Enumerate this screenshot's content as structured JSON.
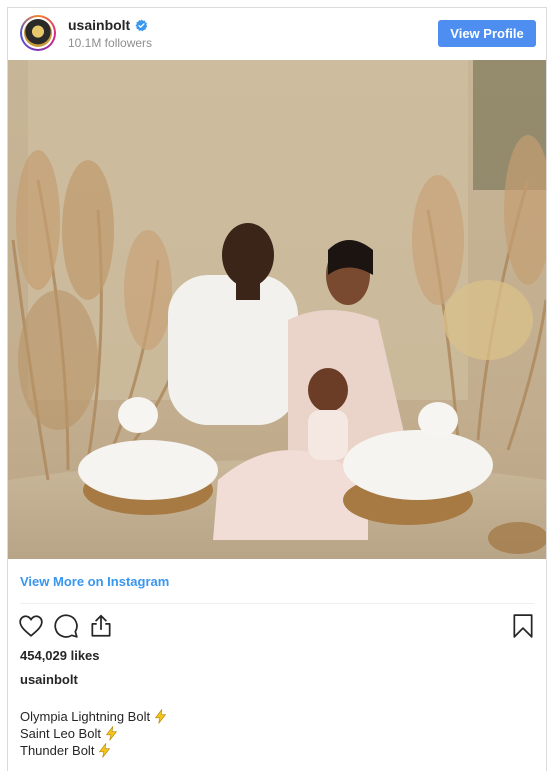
{
  "header": {
    "username": "usainbolt",
    "followers": "10.1M followers",
    "view_profile_label": "View Profile"
  },
  "post": {
    "view_more_label": "View More on Instagram",
    "likes": "454,029 likes",
    "caption_user": "usainbolt",
    "caption_lines": [
      "Olympia Lightning Bolt",
      "Saint Leo Bolt",
      "Thunder Bolt"
    ]
  },
  "icons": {
    "verified": "verified-badge-icon",
    "like": "heart-icon",
    "comment": "comment-icon",
    "share": "share-icon",
    "save": "bookmark-icon",
    "caption_emoji": "lightning-bolt-icon"
  },
  "colors": {
    "button": "#4d8ef0",
    "link": "#3897f0",
    "verified": "#3897f0",
    "bolt": "#f5c518"
  }
}
